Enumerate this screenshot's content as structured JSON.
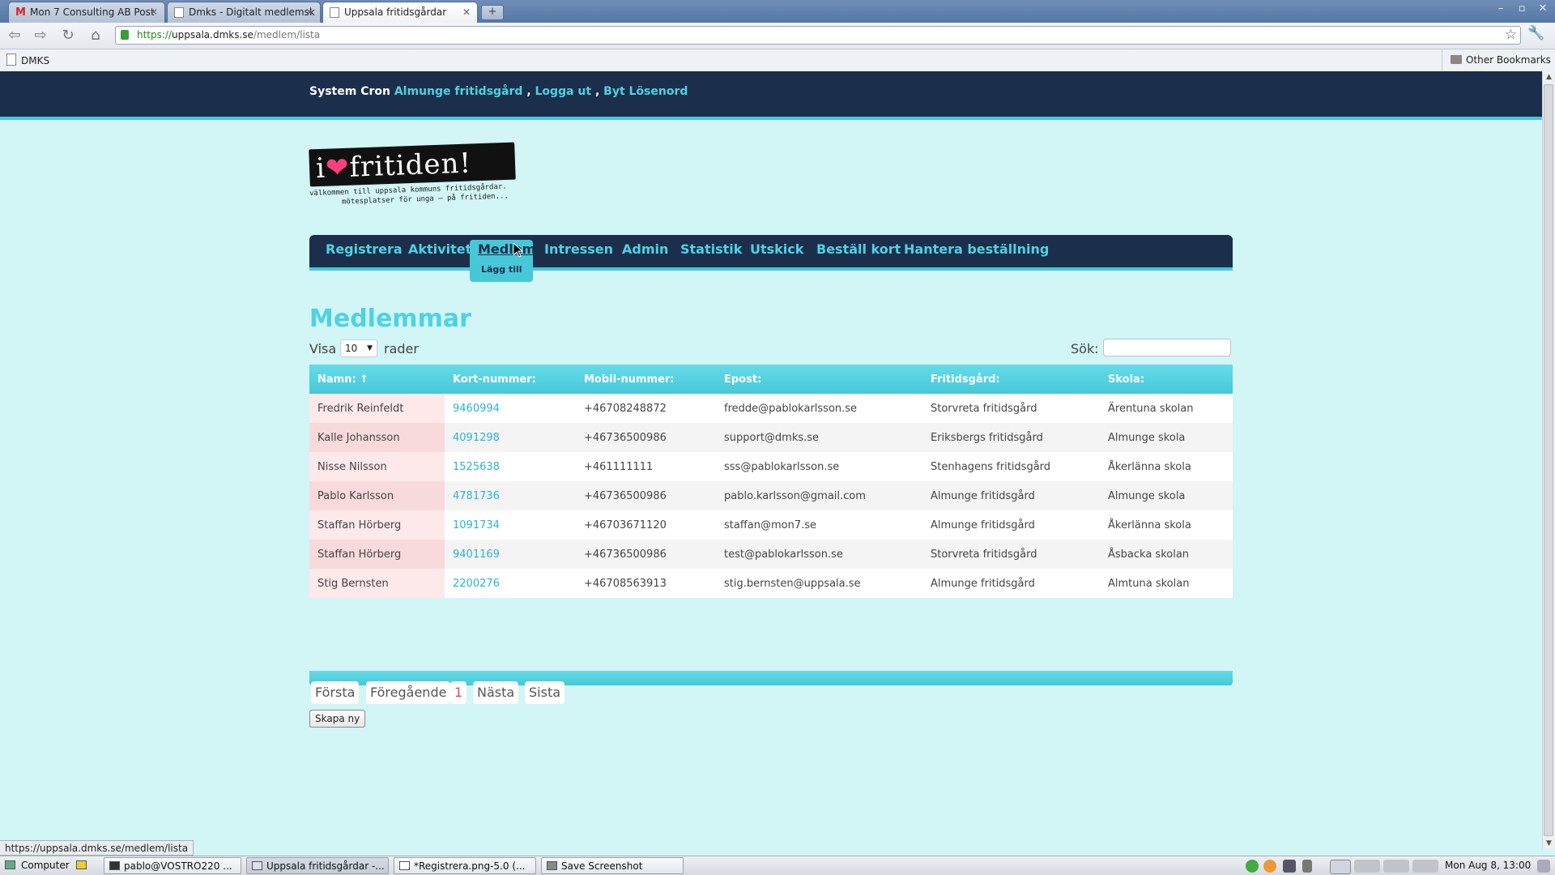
{
  "browser": {
    "tabs": [
      {
        "title": "Mon 7 Consulting AB Post",
        "icon": "gmail-icon"
      },
      {
        "title": "Dmks - Digitalt medlemsk",
        "icon": "page-icon"
      },
      {
        "title": "Uppsala fritidsgårdar",
        "icon": "page-icon"
      }
    ],
    "new_tab_symbol": "+",
    "window_controls": [
      "–",
      "▫",
      "✕"
    ],
    "url": {
      "scheme": "https://",
      "host": "uppsala.dmks.se",
      "path": "/medlem/lista"
    },
    "bookmarks": {
      "first": "DMKS",
      "other": "Other Bookmarks"
    },
    "status_url": "https://uppsala.dmks.se/medlem/lista"
  },
  "site": {
    "user_line": {
      "name": "System Cron",
      "club": "Almunge fritidsgård",
      "sep1": ",",
      "logout": "Logga ut",
      "sep2": ",",
      "change_password": "Byt Lösenord"
    },
    "logo": {
      "prefix": "i",
      "heart": "❤",
      "word": "fritiden!",
      "tagline1": "välkommen till uppsala kommuns fritidsgårdar.",
      "tagline2": "mötesplatser för unga – på fritiden..."
    },
    "nav": {
      "registrera": "Registrera",
      "aktivitet": "Aktivitet",
      "medlem": "Medlem",
      "medlem_sub": "Lägg till",
      "intressen": "Intressen",
      "admin": "Admin",
      "statistik": "Statistik",
      "utskick": "Utskick",
      "bestall_kort": "Beställ kort",
      "hantera": "Hantera beställning"
    },
    "page_title": "Medlemmar",
    "length": {
      "pre": "Visa",
      "value": "10",
      "post": "rader"
    },
    "search_label": "Sök:",
    "columns": [
      "Namn: ↑",
      "Kort-nummer:",
      "Mobil-nummer:",
      "Epost:",
      "Fritidsgård:",
      "Skola:"
    ],
    "rows": [
      [
        "Fredrik Reinfeldt",
        "9460994",
        "+46708248872",
        "fredde@pablokarlsson.se",
        "Storvreta fritidsgård",
        "Ärentuna skolan"
      ],
      [
        "Kalle Johansson",
        "4091298",
        "+46736500986",
        "support@dmks.se",
        "Eriksbergs fritidsgård",
        "Almunge skola"
      ],
      [
        "Nisse Nilsson",
        "1525638",
        "+461111111",
        "sss@pablokarlsson.se",
        "Stenhagens fritidsgård",
        "Åkerlänna skola"
      ],
      [
        "Pablo Karlsson",
        "4781736",
        "+46736500986",
        "pablo.karlsson@gmail.com",
        "Almunge fritidsgård",
        "Almunge skola"
      ],
      [
        "Staffan Hörberg",
        "1091734",
        "+46703671120",
        "staffan@mon7.se",
        "Almunge fritidsgård",
        "Åkerlänna skola"
      ],
      [
        "Staffan Hörberg",
        "9401169",
        "+46736500986",
        "test@pablokarlsson.se",
        "Storvreta fritidsgård",
        "Åsbacka skolan"
      ],
      [
        "Stig Bernsten",
        "2200276",
        "+46708563913",
        "stig.bernsten@uppsala.se",
        "Almunge fritidsgård",
        "Almtuna skolan"
      ]
    ],
    "pager": {
      "first": "Första",
      "prev": "Föregående",
      "current": "1",
      "next": "Nästa",
      "last": "Sista"
    },
    "create_button": "Skapa ny"
  },
  "taskbar": {
    "start": "Computer",
    "tasks": [
      "pablo@VOSTRO220 ...",
      "Uppsala fritidsgårdar -...",
      "*Registrera.png-5.0 (...",
      "Save Screenshot"
    ],
    "clock": "Mon Aug  8, 13:00"
  },
  "colors": {
    "nav_bg": "#1b2f4c",
    "accent": "#46c8d8",
    "link": "#4fd2e2",
    "page_bg": "#d2f5f5",
    "pager_current": "#e04a5a"
  }
}
